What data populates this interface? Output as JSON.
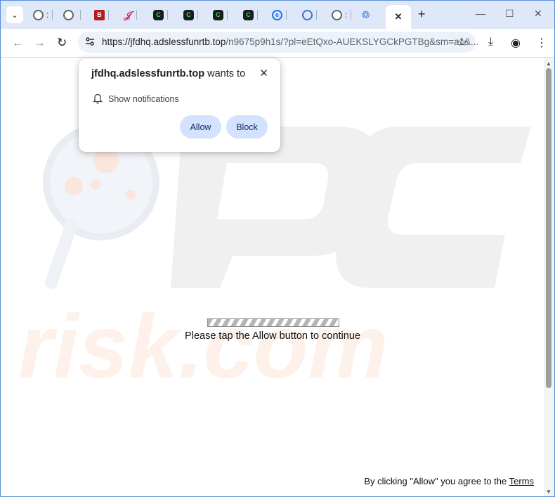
{
  "browser": {
    "tabs_menu_glyph": "⌄",
    "tabs": [
      {
        "icon": "globe-icon",
        "label": ":"
      },
      {
        "icon": "globe-icon",
        "label": ""
      },
      {
        "icon": "b-logo-icon",
        "label": "B"
      },
      {
        "icon": "f-logo-icon",
        "label": "𝒥"
      },
      {
        "icon": "green-app-icon",
        "label": "C"
      },
      {
        "icon": "green-app-icon",
        "label": "C"
      },
      {
        "icon": "green-app-icon",
        "label": "C"
      },
      {
        "icon": "green-app-icon",
        "label": "C"
      },
      {
        "icon": "blue-e-icon",
        "label": "e"
      },
      {
        "icon": "ring-icon",
        "label": "◎"
      },
      {
        "icon": "globe-icon",
        "label": ":"
      },
      {
        "icon": "recycle-icon",
        "label": "♲"
      }
    ],
    "active_tab_close": "✕",
    "new_tab": "+",
    "window": {
      "minimize": "—",
      "maximize": "☐",
      "close": "✕"
    },
    "nav": {
      "back": "←",
      "forward": "→",
      "reload": "↻"
    },
    "url_host": "https://jfdhq.adslessfunrtb.top",
    "url_rest": "/n9675p9h1s/?pl=eEtQxo-AUEKSLYGCkPGTBg&sm=a1&...",
    "toolbar_icons": {
      "star": "☆",
      "download": "⤓",
      "profile": "◉",
      "menu": "⋮"
    }
  },
  "popup": {
    "host": "jfdhq.adslessfunrtb.top",
    "wants_to": " wants to",
    "permission": "Show notifications",
    "allow_label": "Allow",
    "block_label": "Block",
    "close": "✕"
  },
  "page": {
    "message": "Please tap the Allow button to continue",
    "footer_text": "By clicking \"Allow\" you agree to the ",
    "terms_link": "Terms"
  },
  "colors": {
    "tabstrip_bg": "#dfe8f8",
    "omnibox_bg": "#edf2fa",
    "button_bg": "#d3e3fd",
    "frame_border": "#5b8fd6"
  }
}
